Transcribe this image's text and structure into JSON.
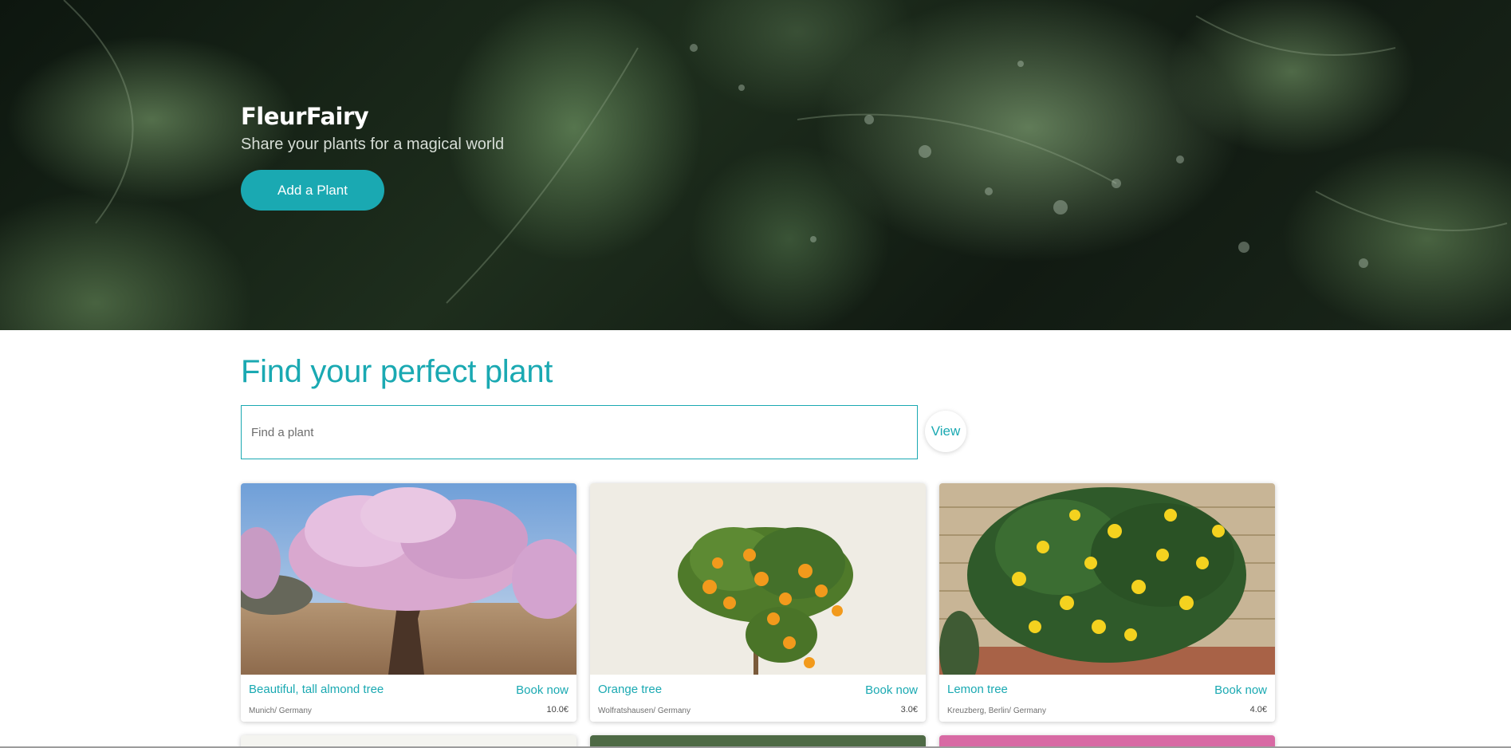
{
  "hero": {
    "brand": "FleurFairy",
    "tagline": "Share your plants for a magical world",
    "add_button": "Add a Plant"
  },
  "main": {
    "title": "Find your perfect plant",
    "search": {
      "placeholder": "Find a plant",
      "value": ""
    },
    "view_button": "View"
  },
  "cards": [
    {
      "title": "Beautiful, tall almond tree",
      "action": "Book now",
      "location": "Munich/ Germany",
      "price": "10.0€",
      "image": "almond-tree-image"
    },
    {
      "title": "Orange tree",
      "action": "Book now",
      "location": "Wolfratshausen/ Germany",
      "price": "3.0€",
      "image": "orange-tree-image"
    },
    {
      "title": "Lemon tree",
      "action": "Book now",
      "location": "Kreuzberg, Berlin/ Germany",
      "price": "4.0€",
      "image": "lemon-tree-image"
    }
  ],
  "colors": {
    "accent": "#1aa9b2",
    "hero_dark": "#111a12"
  }
}
